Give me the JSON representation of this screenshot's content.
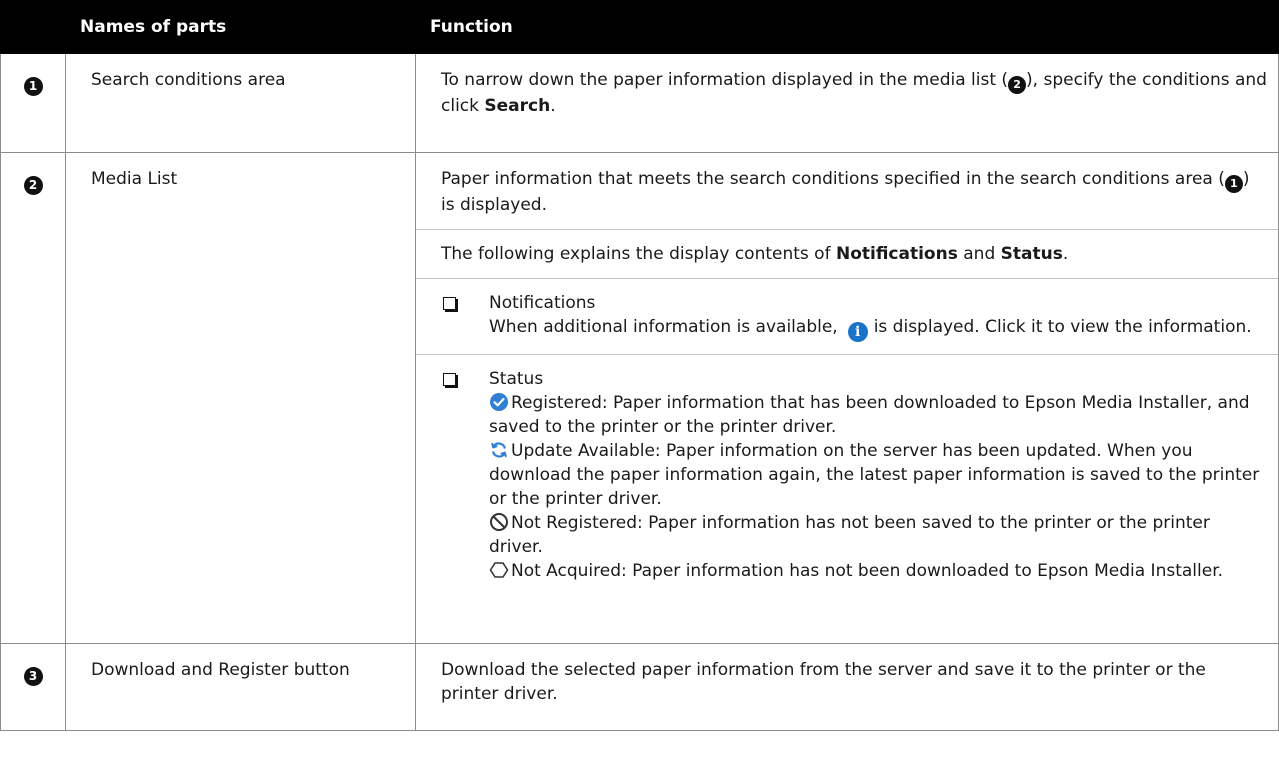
{
  "header": {
    "col_names": "Names of parts",
    "col_function": "Function"
  },
  "rows": [
    {
      "num": "1",
      "name": "Search conditions area",
      "func_a": "To narrow down the paper information displayed in the media list (",
      "func_num": "2",
      "func_b": "), specify the conditions and click ",
      "func_bold": "Search",
      "func_c": "."
    },
    {
      "num": "2",
      "name": "Media List",
      "p1_a": "Paper information that meets the search conditions specified in the search conditions area (",
      "p1_num": "1",
      "p1_b": ") is displayed.",
      "p2_a": "The following explains the display contents of ",
      "p2_bold1": "Notifications",
      "p2_and": " and ",
      "p2_bold2": "Status",
      "p2_end": ".",
      "notif_title": "Notifications",
      "notif_a": "When additional information is available,",
      "notif_b": "is displayed. Click it to view the information.",
      "status_title": "Status",
      "status_items": [
        {
          "icon": "registered-icon",
          "text": "Registered: Paper information that has been downloaded to Epson Media Installer, and saved to the printer or the printer driver."
        },
        {
          "icon": "update-available-icon",
          "text": "Update Available: Paper information on the server has been updated. When you download the paper information again, the latest paper information is saved to the printer or the printer driver."
        },
        {
          "icon": "not-registered-icon",
          "text": "Not Registered: Paper information has not been saved to the printer or the printer driver."
        },
        {
          "icon": "not-acquired-icon",
          "text": "Not Acquired: Paper information has not been downloaded to Epson Media Installer."
        }
      ]
    },
    {
      "num": "3",
      "name": "Download and Register button",
      "func": "Download the selected paper information from the server and save it to the printer or the printer driver."
    }
  ],
  "colors": {
    "header_bg": "#000000",
    "info_icon": "#1b74c8",
    "registered_icon": "#2f7fd6"
  }
}
